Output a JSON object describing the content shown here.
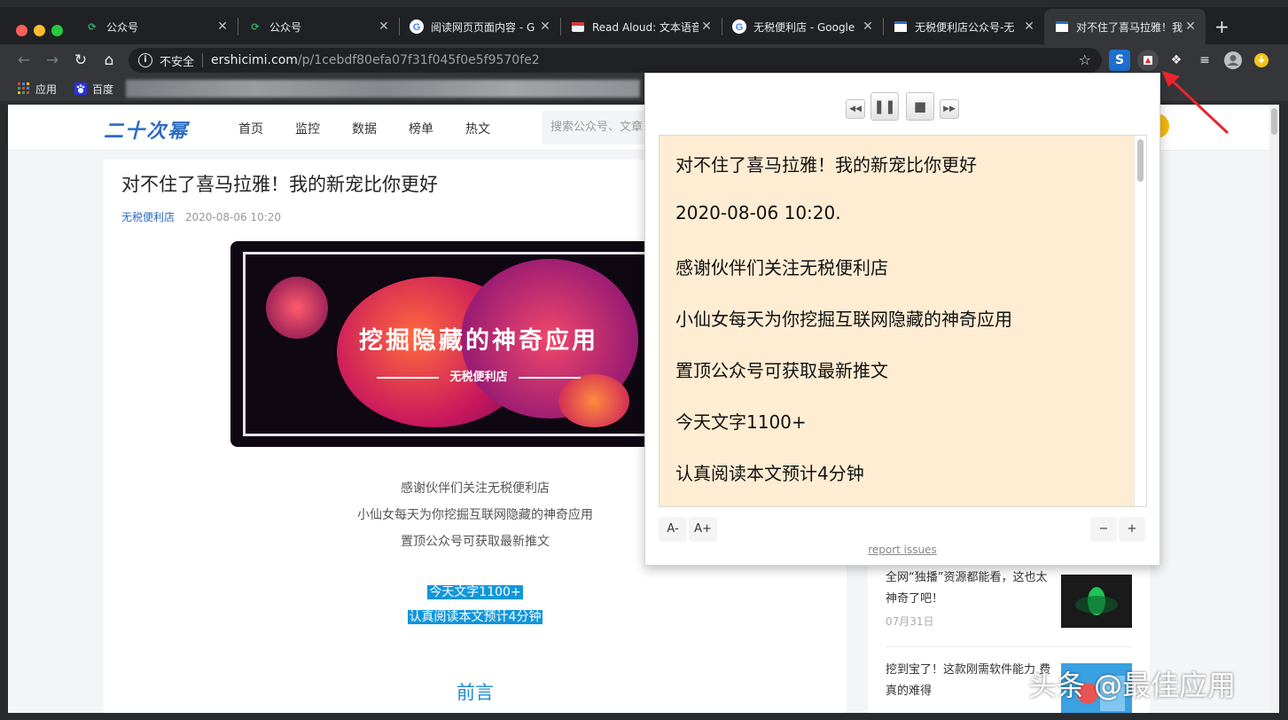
{
  "browser": {
    "tabs": [
      {
        "label": "公众号",
        "icon": "wechat-green-icon"
      },
      {
        "label": "公众号",
        "icon": "wechat-green-icon"
      },
      {
        "label": "阅读网页页面内容 - G",
        "icon": "google-icon"
      },
      {
        "label": "Read Aloud: 文本语音",
        "icon": "read-aloud-icon"
      },
      {
        "label": "无税便利店 - Google",
        "icon": "google-icon"
      },
      {
        "label": "无税便利店公众号-无",
        "icon": "page-icon"
      },
      {
        "label": "对不住了喜马拉雅！我",
        "icon": "page-icon"
      }
    ],
    "new_tab": "+",
    "address": {
      "security_label": "不安全",
      "host": "ershicimi.com",
      "path": "/p/1cebdf80efa07f31f045f0e5f9570fe2"
    },
    "bookmarks": [
      {
        "label": "应用",
        "icon": "apps-grid-icon"
      },
      {
        "label": "百度",
        "icon": "baidu-paw-icon"
      }
    ]
  },
  "site": {
    "logo": "二十次幂",
    "nav": [
      "首页",
      "监控",
      "数据",
      "榜单",
      "热文"
    ],
    "search_placeholder": "搜索公众号、文章"
  },
  "article": {
    "title": "对不住了喜马拉雅！我的新宠比你更好",
    "author": "无税便利店",
    "date": "2020-08-06 10:20",
    "banner_title": "挖掘隐藏的神奇应用",
    "banner_sub": "无税便利店",
    "paragraphs": [
      "感谢伙伴们关注无税便利店",
      "小仙女每天为你挖掘互联网隐藏的神奇应用",
      "置顶公众号可获取最新推文"
    ],
    "highlighted": [
      "今天文字1100+",
      "认真阅读本文预计4分钟"
    ],
    "section": "前言"
  },
  "sidebar": {
    "items": [
      {
        "title": "全网“独播”资源都能看，这也太神奇了吧！",
        "date": "07月31日"
      },
      {
        "title": "挖到宝了！这款刚需软件能力 费真的难得",
        "date": ""
      }
    ]
  },
  "read_aloud": {
    "lines": [
      "对不住了喜马拉雅！我的新宠比你更好",
      "2020-08-06 10:20.",
      "感谢伙伴们关注无税便利店",
      "小仙女每天为你挖掘互联网隐藏的神奇应用",
      "置顶公众号可获取最新推文",
      "今天文字1100+",
      "认真阅读本文预计4分钟"
    ],
    "font_smaller": "A-",
    "font_larger": "A+",
    "rate_down": "−",
    "rate_up": "+",
    "report": "report issues"
  },
  "watermark": "头条 @最佳应用",
  "colors": {
    "accent_blue": "#2b6bc4",
    "highlight": "#1296db",
    "reader_bg": "#feedd3",
    "arrow_red": "#e8262b"
  }
}
